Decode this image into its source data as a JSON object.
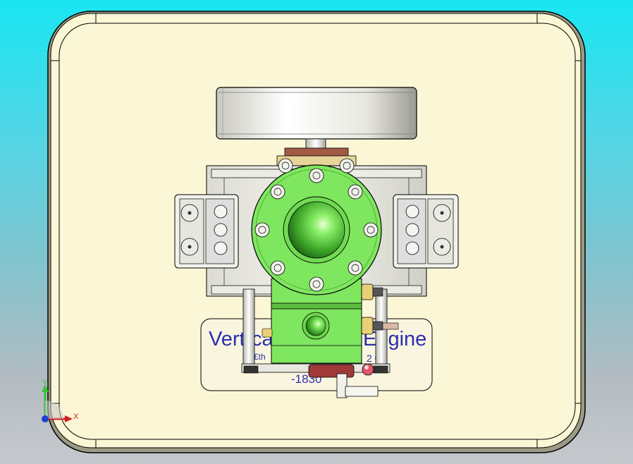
{
  "view": {
    "mode": "shaded-with-edges",
    "colors": {
      "background_top": "#19e6f2",
      "background_bottom": "#c6c9cd",
      "base_plate": "#fbf7d6",
      "cylinder_head": "#7fe65f",
      "flywheel": "#e4e4dc",
      "label_text": "#2b2fb0"
    }
  },
  "model": {
    "name_plate": {
      "text_main_left": "Vert",
      "text_main_mid": "ca",
      "text_main_right": "Engine",
      "text_sub_left": "£th",
      "text_sub_right": "2 0",
      "text_year": "-1830"
    }
  },
  "triad": {
    "x_label": "X",
    "y_label": "Y",
    "icon": "coordinate-triad-icon"
  }
}
